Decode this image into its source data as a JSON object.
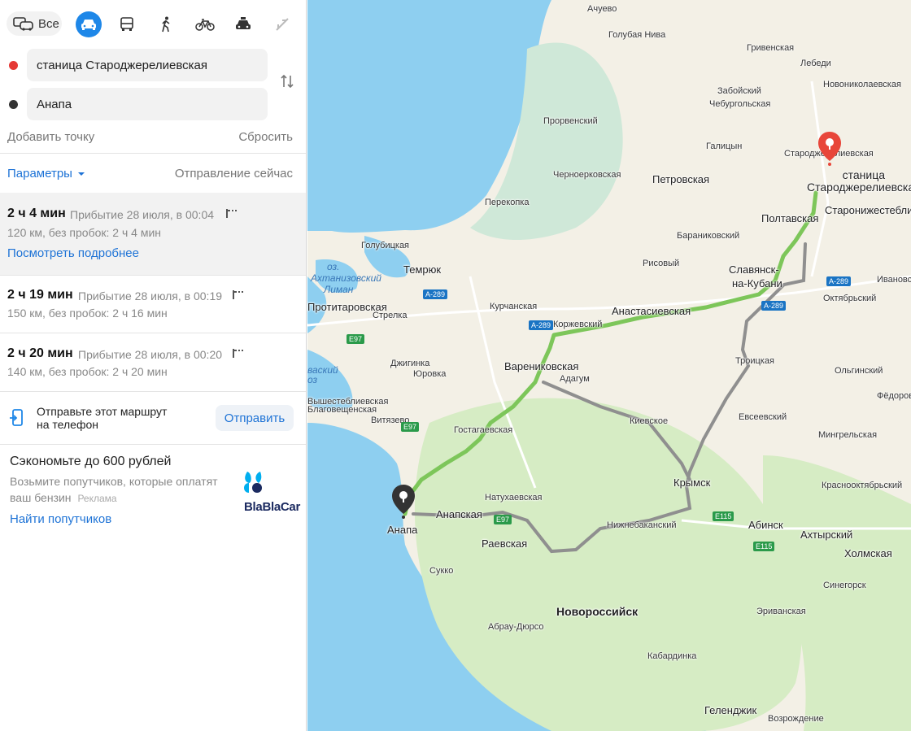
{
  "modes": {
    "all_label": "Все",
    "items": [
      {
        "icon": "car-icon",
        "active": true
      },
      {
        "icon": "bus-icon",
        "active": false
      },
      {
        "icon": "walk-icon",
        "active": false
      },
      {
        "icon": "bicycle-icon",
        "active": false
      },
      {
        "icon": "taxi-icon",
        "active": false
      },
      {
        "icon": "plane-icon",
        "active": false
      }
    ]
  },
  "route_points": {
    "from": "станица Староджерелиевская",
    "to": "Анапа",
    "from_color": "#e53935",
    "to_color": "#333333"
  },
  "actions": {
    "add_point": "Добавить точку",
    "reset": "Сбросить",
    "params": "Параметры",
    "departure": "Отправление сейчас"
  },
  "routes": [
    {
      "time": "2 ч 4 мин",
      "arrival": "Прибытие 28 июля, в 00:04",
      "distance": "120 км, без пробок: 2 ч 4 мин",
      "details_link": "Посмотреть подробнее"
    },
    {
      "time": "2 ч 19 мин",
      "arrival": "Прибытие 28 июля, в 00:19",
      "distance": "150 км, без пробок: 2 ч 16 мин"
    },
    {
      "time": "2 ч 20 мин",
      "arrival": "Прибытие 28 июля, в 00:20",
      "distance": "140 км, без пробок: 2 ч 20 мин"
    }
  ],
  "send_to_phone": {
    "text_line1": "Отправьте этот маршрут",
    "text_line2": "на телефон",
    "button": "Отправить"
  },
  "promo": {
    "title": "Сэкономьте до 600 рублей",
    "text_line1": "Возьмите попутчиков, которые оплатят",
    "text_line2": "ваш бензин",
    "ad_label": "Реклама",
    "link": "Найти попутчиков",
    "brand": "BlaBlaCar"
  },
  "map": {
    "colors": {
      "water": "#8ecff0",
      "land": "#f3f0e6",
      "forest": "#d6ecc4",
      "route_main": "#7dc65a",
      "route_alt": "#9a9a9a",
      "marker_dest": "#e8463a"
    },
    "dest_label_line1": "станица",
    "dest_label_line2": "Староджерелиевская",
    "labels": [
      "Ачуево",
      "Голубая Нива",
      "Гривенская",
      "Лебеди",
      "Забойский",
      "Чебургольская",
      "Новониколаевская",
      "Прорвенский",
      "Галицын",
      "Староджерелиевская",
      "Черноерковская",
      "Петровская",
      "Перекопка",
      "Полтавская",
      "Старонижестеблиевская",
      "Голубицкая",
      "Темрюк",
      "Бараниковский",
      "Рисовый",
      "Славянск-",
      "на-Кубани",
      "Ивановская",
      "Курчанская",
      "Анастасиевская",
      "Октябрьский",
      "Коржевский",
      "Стрелка",
      "Джигинка",
      "Юровка",
      "Варениковская",
      "Адагум",
      "Троицкая",
      "Ольгинский",
      "Фёдоровская",
      "Киевское",
      "Евсеевский",
      "Гостагаевская",
      "Мингрельская",
      "Витязево",
      "Крымск",
      "Натухаевская",
      "Краснооктябрьский",
      "Анапская",
      "Нижнебаканский",
      "Абинск",
      "Ахтырский",
      "Раевская",
      "Холмская",
      "Анапа",
      "Сукко",
      "Синегорск",
      "Новороссийск",
      "Эриванская",
      "Абрау-Дюрсо",
      "Кабардинка",
      "Геленджик",
      "Возрождение",
      "Протитаровская",
      "оз.",
      "Ахтанизовский",
      "Лиман",
      "ваский",
      "оз",
      "Вышестеблиевская",
      "Благовещенская"
    ],
    "shields": [
      "A-289",
      "A-289",
      "A-289",
      "A-289",
      "E97",
      "E97",
      "E97",
      "E115",
      "E115"
    ]
  }
}
